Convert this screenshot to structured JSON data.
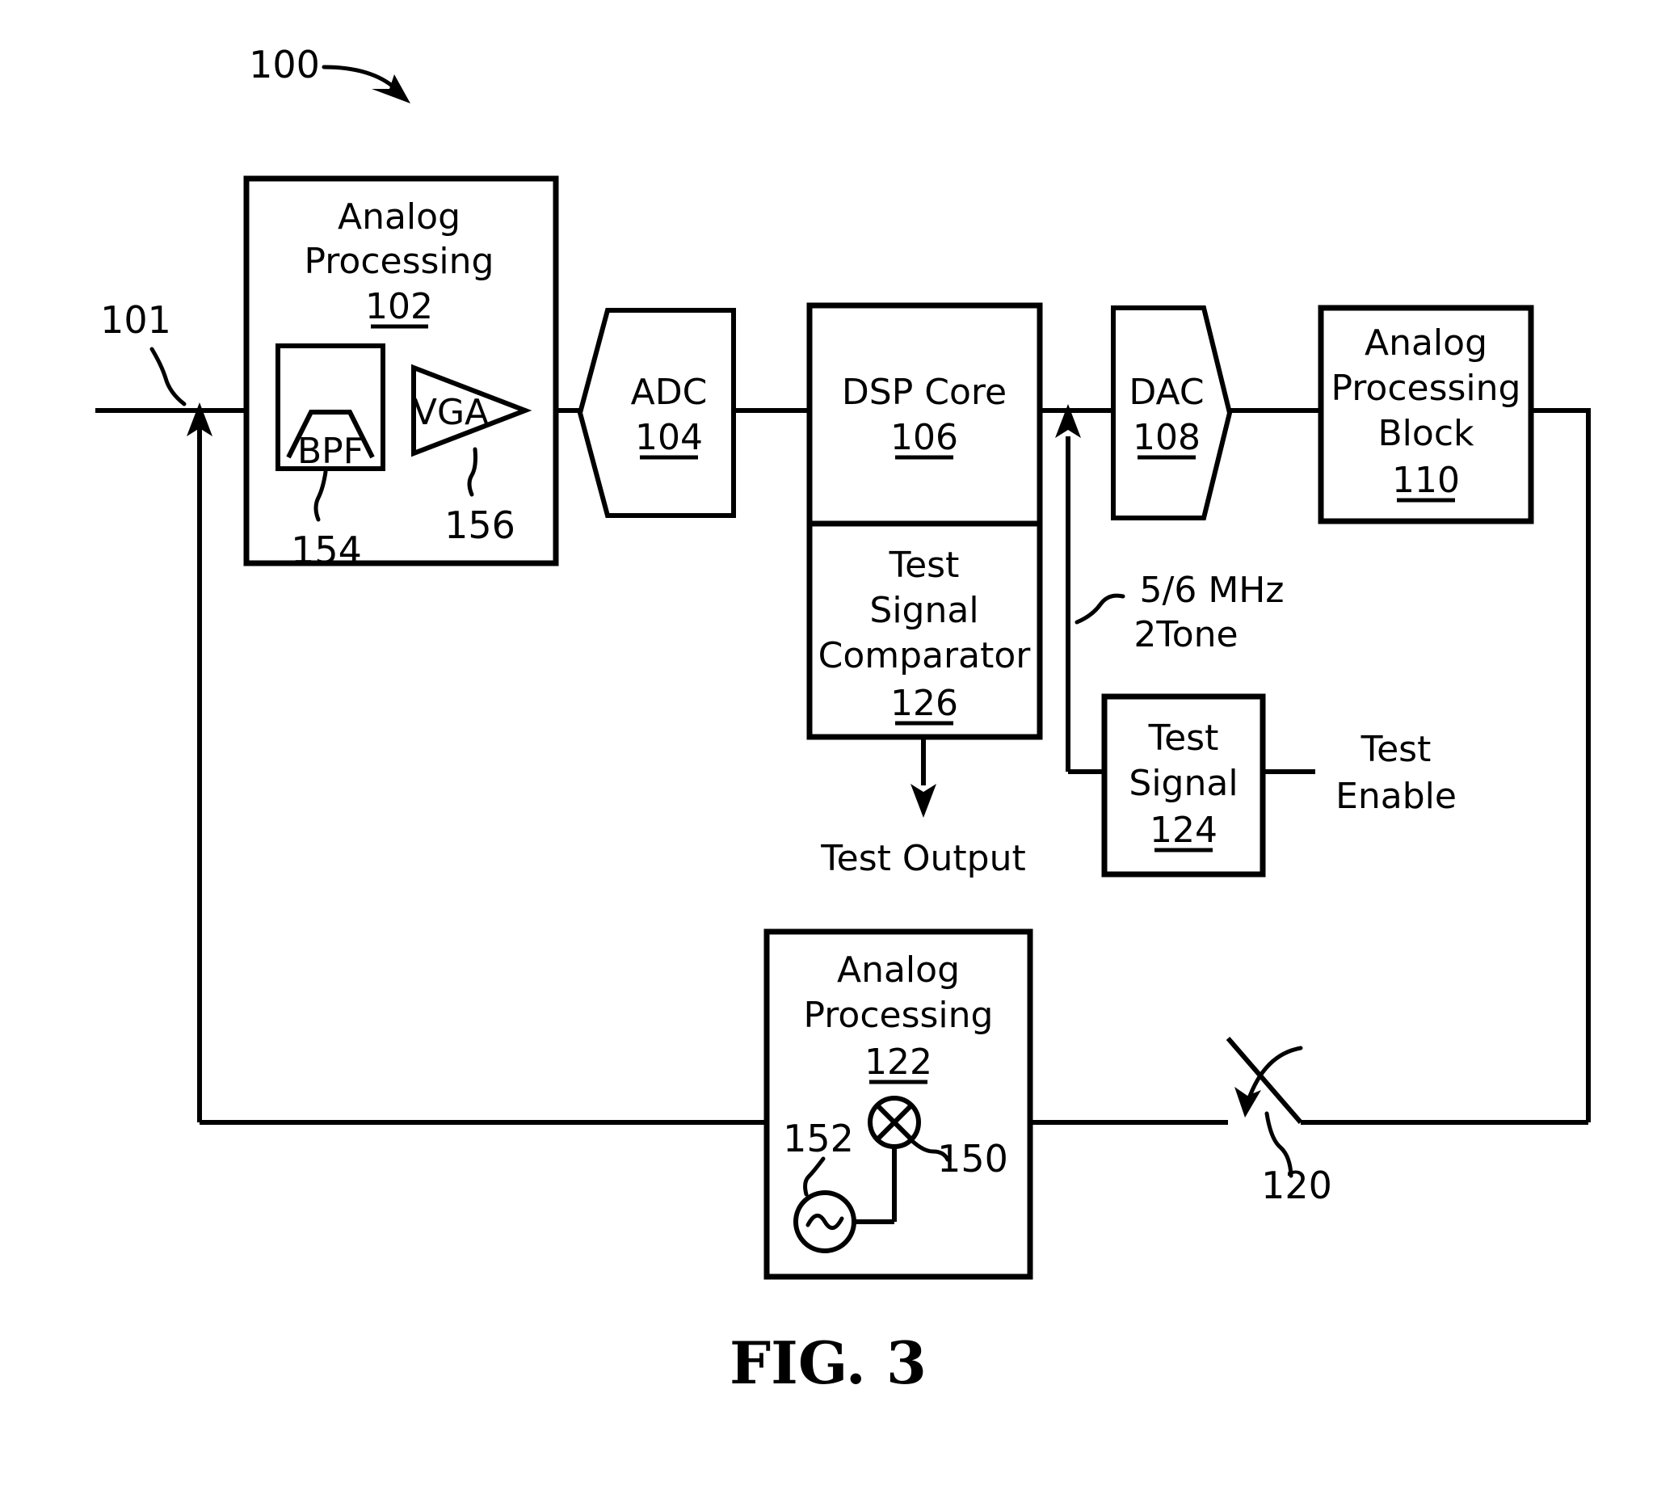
{
  "figure": {
    "caption": "FIG. 3",
    "system_ref": "100",
    "input_ref": "101"
  },
  "blocks": {
    "analog_processing_102": {
      "title_line1": "Analog",
      "title_line2": "Processing",
      "ref": "102",
      "bpf_label": "BPF",
      "bpf_ref": "154",
      "vga_label": "VGA",
      "vga_ref": "156"
    },
    "adc_104": {
      "label": "ADC",
      "ref": "104"
    },
    "dsp_core_106": {
      "label": "DSP Core",
      "ref": "106"
    },
    "test_signal_comparator_126": {
      "line1": "Test",
      "line2": "Signal",
      "line3": "Comparator",
      "ref": "126"
    },
    "dac_108": {
      "label": "DAC",
      "ref": "108"
    },
    "analog_processing_block_110": {
      "line1": "Analog",
      "line2": "Processing",
      "line3": "Block",
      "ref": "110"
    },
    "test_signal_124": {
      "line1": "Test",
      "line2": "Signal",
      "ref": "124"
    },
    "analog_processing_122": {
      "title_line1": "Analog",
      "title_line2": "Processing",
      "ref": "122",
      "mixer_ref": "150",
      "oscillator_ref": "152"
    }
  },
  "annotations": {
    "test_output": "Test Output",
    "test_enable_line1": "Test",
    "test_enable_line2": "Enable",
    "tone_line1": "5/6 MHz",
    "tone_line2": "2Tone",
    "switch_ref": "120"
  },
  "colors": {
    "ink": "#000000",
    "paper": "#ffffff"
  }
}
